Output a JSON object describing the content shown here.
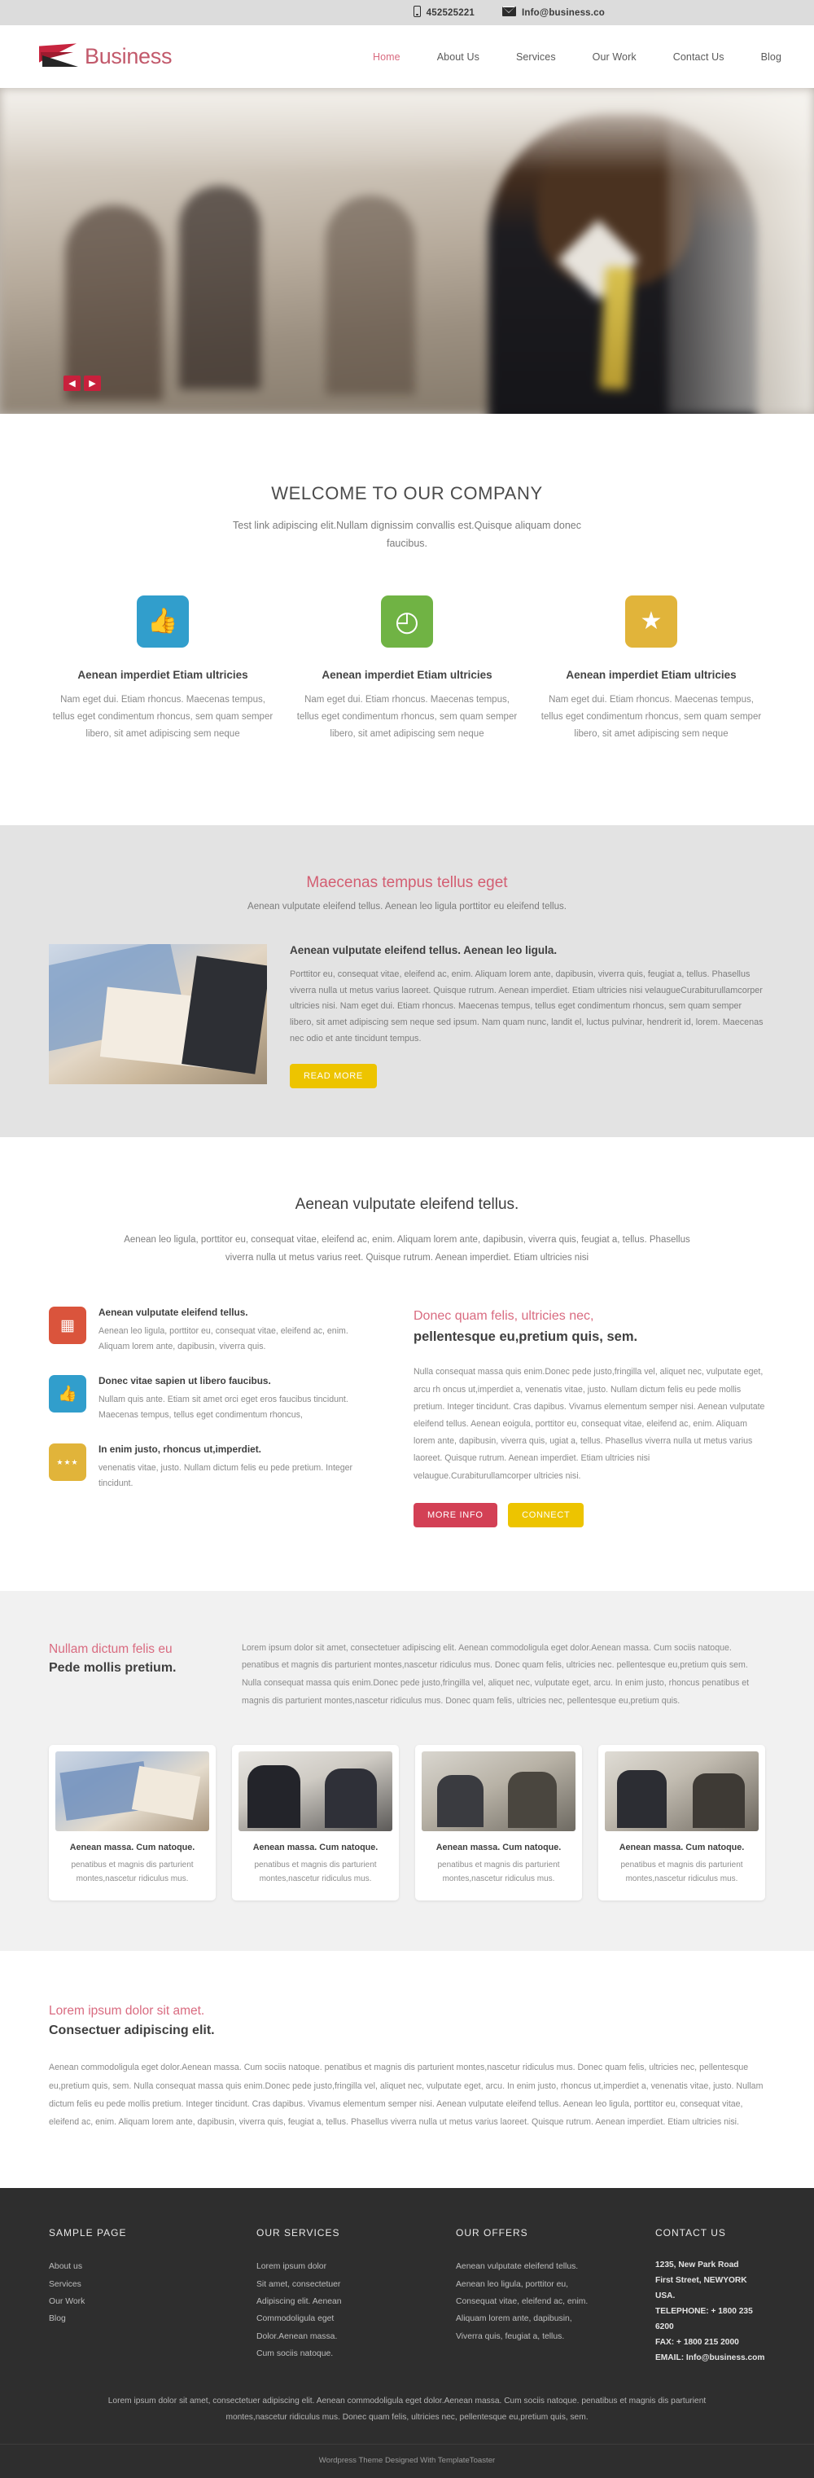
{
  "topbar": {
    "phone": "452525221",
    "email": "Info@business.co"
  },
  "header": {
    "brand": "Business",
    "nav": [
      {
        "label": "Home",
        "active": true
      },
      {
        "label": "About Us",
        "active": false
      },
      {
        "label": "Services",
        "active": false
      },
      {
        "label": "Our Work",
        "active": false
      },
      {
        "label": "Contact Us",
        "active": false
      },
      {
        "label": "Blog",
        "active": false
      }
    ]
  },
  "hero": {
    "prev": "◀",
    "next": "▶"
  },
  "welcome": {
    "title": "WELCOME TO OUR COMPANY",
    "subtitle": "Test link adipiscing elit.Nullam dignissim convallis est.Quisque aliquam donec faucibus.",
    "features": [
      {
        "icon": "thumbs-up-icon",
        "glyph": "👍",
        "color": "#35aadc",
        "title": "Aenean imperdiet Etiam ultricies",
        "text": "Nam eget dui. Etiam rhoncus. Maecenas tempus, tellus eget condimentum rhoncus, sem quam semper libero, sit amet adipiscing sem neque"
      },
      {
        "icon": "clock-icon",
        "glyph": "◴",
        "color": "#79c14a",
        "title": "Aenean imperdiet Etiam ultricies",
        "text": "Nam eget dui. Etiam rhoncus. Maecenas tempus, tellus eget condimentum rhoncus, sem quam semper libero, sit amet adipiscing sem neque"
      },
      {
        "icon": "star-icon",
        "glyph": "★",
        "color": "#f3c23f",
        "title": "Aenean imperdiet Etiam ultricies",
        "text": "Nam eget dui. Etiam rhoncus. Maecenas tempus, tellus eget condimentum rhoncus, sem quam semper libero, sit amet adipiscing sem neque"
      }
    ]
  },
  "maecenas": {
    "title": "Maecenas tempus tellus eget",
    "subtitle": "Aenean vulputate eleifend tellus. Aenean leo ligula porttitor eu eleifend tellus.",
    "heading": "Aenean vulputate eleifend tellus. Aenean leo ligula.",
    "body": "Porttitor eu, consequat vitae, eleifend ac, enim. Aliquam lorem ante, dapibusin, viverra quis, feugiat a, tellus. Phasellus viverra nulla ut metus varius laoreet. Quisque rutrum. Aenean imperdiet. Etiam ultricies nisi velaugueCurabiturullamcorper ultricies nisi. Nam eget dui. Etiam rhoncus. Maecenas tempus, tellus eget condimentum rhoncus, sem quam semper libero, sit amet adipiscing sem neque sed ipsum. Nam quam nunc, landit el, luctus pulvinar, hendrerit id, lorem. Maecenas nec odio et ante tincidunt tempus.",
    "button": "READ MORE"
  },
  "services": {
    "title": "Aenean vulputate eleifend tellus.",
    "lead": "Aenean leo ligula, porttitor eu, consequat vitae, eleifend ac, enim. Aliquam lorem ante, dapibusin, viverra quis, feugiat a, tellus. Phasellus viverra nulla ut metus varius reet. Quisque rutrum. Aenean imperdiet. Etiam ultricies nisi",
    "items": [
      {
        "icon": "window-layout-icon",
        "glyph": "▦",
        "color": "#eb5b41",
        "title": "Aenean vulputate eleifend tellus.",
        "text": "Aenean leo ligula, porttitor eu, consequat vitae, eleifend ac, enim. Aliquam lorem ante, dapibusin, viverra quis."
      },
      {
        "icon": "thumbs-up-icon",
        "glyph": "👍",
        "color": "#35aadc",
        "title": "Donec vitae sapien ut libero faucibus.",
        "text": "Nullam quis ante. Etiam sit amet orci eget eros faucibus tincidunt. Maecenas tempus, tellus eget condimentum rhoncus,"
      },
      {
        "icon": "stars-icon",
        "glyph": "★★★",
        "color": "#f3c23f",
        "title": "In enim justo, rhoncus ut,imperdiet.",
        "text": "venenatis vitae, justo. Nullam dictum felis eu pede  pretium. Integer tincidunt."
      }
    ],
    "right_title_pink": "Donec quam felis, ultricies nec,",
    "right_title_dark": "pellentesque eu,pretium quis, sem.",
    "right_body": "Nulla consequat massa quis enim.Donec pede justo,fringilla vel, aliquet nec, vulputate eget, arcu rh oncus ut,imperdiet a, venenatis vitae, justo. Nullam dictum felis eu pede mollis pretium. Integer tincidunt. Cras dapibus. Vivamus elementum semper nisi. Aenean vulputate eleifend tellus. Aenean eoigula, porttitor eu, consequat vitae, eleifend ac, enim. Aliquam lorem ante, dapibusin, viverra quis, ugiat a, tellus. Phasellus viverra nulla ut metus varius laoreet. Quisque rutrum. Aenean imperdiet. Etiam ultricies nisi velaugue.Curabiturullamcorper ultricies nisi.",
    "btn_more": "MORE INFO",
    "btn_connect": "CONNECT"
  },
  "portfolio": {
    "title_pink": "Nullam dictum felis eu",
    "title_dark": "Pede mollis pretium.",
    "body": "Lorem ipsum dolor sit amet, consectetuer adipiscing elit. Aenean commodoligula eget dolor.Aenean massa. Cum sociis natoque. penatibus et magnis dis parturient montes,nascetur ridiculus mus. Donec quam felis, ultricies nec. pellentesque eu,pretium quis sem. Nulla consequat massa quis enim.Donec pede justo,fringilla vel, aliquet nec, vulputate eget, arcu. In enim justo, rhoncus penatibus et magnis dis parturient montes,nascetur ridiculus mus. Donec quam felis, ultricies nec, pellentesque eu,pretium quis.",
    "cards": [
      {
        "title": "Aenean massa. Cum natoque.",
        "text": "penatibus et magnis dis parturient montes,nascetur ridiculus mus."
      },
      {
        "title": "Aenean massa. Cum natoque.",
        "text": "penatibus et magnis dis parturient montes,nascetur ridiculus mus."
      },
      {
        "title": "Aenean massa. Cum natoque.",
        "text": "penatibus et magnis dis parturient montes,nascetur ridiculus mus."
      },
      {
        "title": "Aenean massa. Cum natoque.",
        "text": "penatibus et magnis dis parturient montes,nascetur ridiculus mus."
      }
    ]
  },
  "lorem": {
    "title_pink": "Lorem ipsum dolor sit amet.",
    "title_dark": "Consectuer adipiscing elit.",
    "body": "Aenean commodoligula eget dolor.Aenean massa. Cum sociis natoque. penatibus et magnis dis parturient montes,nascetur ridiculus mus. Donec quam felis, ultricies nec, pellentesque eu,pretium quis, sem. Nulla consequat massa quis enim.Donec pede justo,fringilla vel, aliquet nec, vulputate eget, arcu. In enim justo, rhoncus ut,imperdiet a, venenatis vitae, justo. Nullam dictum felis eu pede mollis pretium. Integer tincidunt. Cras dapibus. Vivamus elementum semper nisi. Aenean vulputate eleifend tellus. Aenean leo ligula, porttitor eu, consequat vitae, eleifend ac, enim. Aliquam lorem ante, dapibusin, viverra quis, feugiat a, tellus. Phasellus viverra nulla ut metus varius laoreet. Quisque rutrum. Aenean imperdiet. Etiam ultricies nisi."
  },
  "footer": {
    "col1": {
      "title": "SAMPLE PAGE",
      "links": [
        "About us",
        "Services",
        "Our Work",
        "Blog"
      ]
    },
    "col2": {
      "title": "OUR SERVICES",
      "links": [
        "Lorem ipsum dolor",
        "Sit amet, consectetuer",
        "Adipiscing elit. Aenean",
        "Commodoligula eget",
        "Dolor.Aenean massa.",
        "Cum sociis natoque."
      ]
    },
    "col3": {
      "title": "OUR OFFERS",
      "links": [
        "Aenean vulputate eleifend tellus.",
        "Aenean leo ligula, porttitor eu,",
        "Consequat vitae, eleifend ac, enim.",
        "Aliquam lorem ante, dapibusin,",
        "Viverra quis, feugiat a, tellus."
      ]
    },
    "col4": {
      "title": "CONTACT US",
      "line1": "1235, New Park Road",
      "line2": "First Street, NEWYORK",
      "line3": "USA.",
      "line4": "TELEPHONE: + 1800 235 6200",
      "line5": "FAX: + 1800 215 2000",
      "line6": "EMAIL: Info@business.com"
    },
    "bottom_text": "Lorem ipsum dolor sit amet, consectetuer adipiscing elit. Aenean commodoligula eget dolor.Aenean massa. Cum sociis natoque. penatibus et magnis dis parturient montes,nascetur ridiculus mus. Donec quam felis, ultricies nec, pellentesque eu,pretium quis, sem.",
    "credit": "Wordpress Theme Designed With TemplateToaster"
  },
  "colors": {
    "accent_pink": "#d96b80",
    "accent_red": "#d34055",
    "accent_yellow": "#edc400",
    "footer_bg": "#2e2e2e"
  }
}
